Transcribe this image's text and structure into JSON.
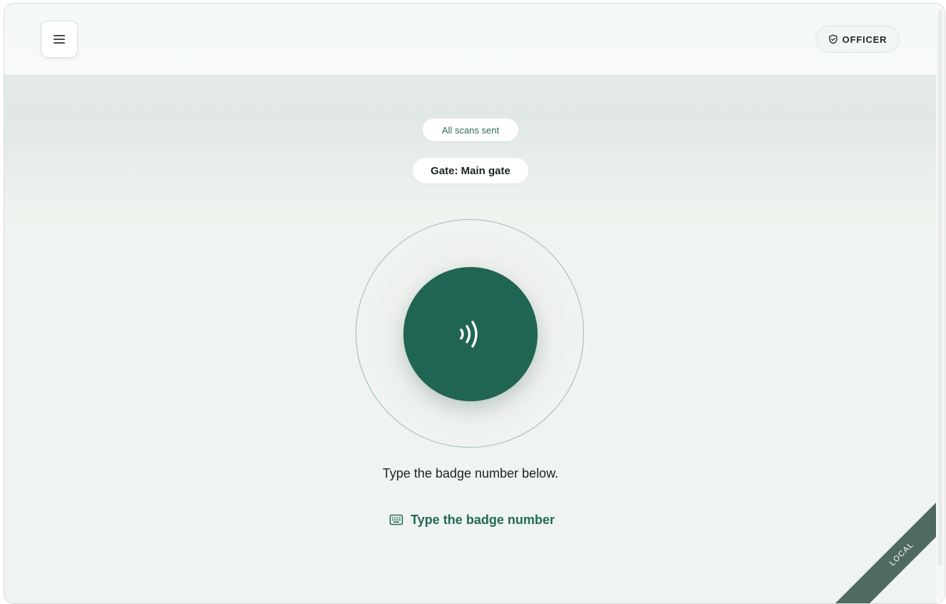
{
  "header": {
    "menu_icon": "hamburger-menu-icon",
    "role_icon": "shield-check-icon",
    "role_label": "OFFICER"
  },
  "status": {
    "sync_label": "All scans sent",
    "gate_label": "Gate: Main gate"
  },
  "scanner": {
    "icon": "contactless-nfc-icon",
    "instruction": "Type the badge number below.",
    "manual_entry_icon": "keyboard-icon",
    "manual_entry_label": "Type the badge number"
  },
  "environment": {
    "label": "LOCAL"
  },
  "colors": {
    "accent": "#206553",
    "accent_text": "#236a55",
    "ring": "#9bbcb2",
    "ribbon": "#4e6a62",
    "background": "#eff4f3"
  }
}
